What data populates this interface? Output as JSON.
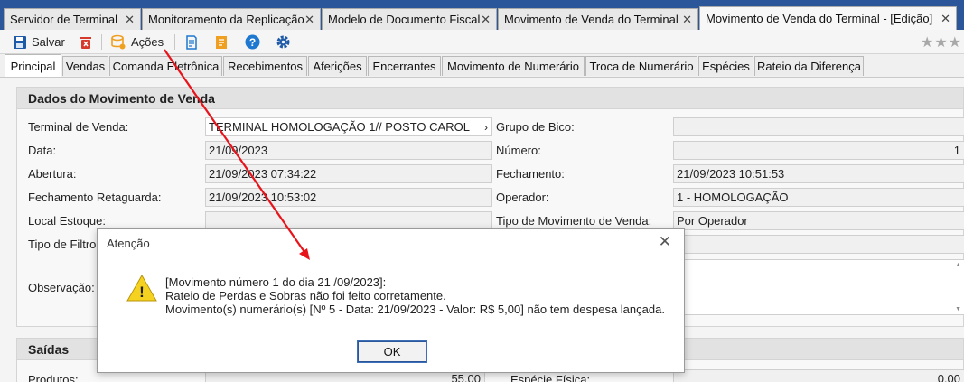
{
  "doc_tabs": [
    {
      "label": "Servidor de Terminal"
    },
    {
      "label": "Monitoramento da Replicação"
    },
    {
      "label": "Modelo de Documento Fiscal"
    },
    {
      "label": "Movimento de Venda do Terminal"
    },
    {
      "label": "Movimento de Venda do Terminal - [Edição]"
    }
  ],
  "close_glyph": "✕",
  "toolbar": {
    "save_label": "Salvar",
    "actions_label": "Ações",
    "help_glyph": "?",
    "stars": "★★★"
  },
  "page_tabs": [
    {
      "label": "Principal"
    },
    {
      "label": "Vendas"
    },
    {
      "label": "Comanda Eletrônica"
    },
    {
      "label": "Recebimentos"
    },
    {
      "label": "Aferições"
    },
    {
      "label": "Encerrantes"
    },
    {
      "label": "Movimento de Numerário"
    },
    {
      "label": "Troca de Numerário"
    },
    {
      "label": "Espécies"
    },
    {
      "label": "Rateio da Diferença"
    }
  ],
  "dados": {
    "title": "Dados do Movimento de Venda",
    "terminal_label": "Terminal de Venda:",
    "terminal_value": "TERMINAL HOMOLOGAÇÃO 1// POSTO CAROL",
    "terminal_arrow": "›",
    "grupo_label": "Grupo de Bico:",
    "grupo_value": "",
    "data_label": "Data:",
    "data_value": "21/09/2023",
    "numero_label": "Número:",
    "numero_value": "1",
    "abertura_label": "Abertura:",
    "abertura_value": "21/09/2023 07:34:22",
    "fechamento_label": "Fechamento:",
    "fechamento_value": "21/09/2023 10:51:53",
    "fech_ret_label": "Fechamento Retaguarda:",
    "fech_ret_value": "21/09/2023 10:53:02",
    "operador_label": "Operador:",
    "operador_value": "1 - HOMOLOGAÇÃO",
    "local_label": "Local Estoque:",
    "local_value": "",
    "tipo_mov_label": "Tipo de Movimento de Venda:",
    "tipo_mov_value": "Por Operador",
    "tipo_filtro_label": "Tipo de Filtro",
    "obs_label": "Observação:"
  },
  "saidas": {
    "title": "Saídas",
    "produtos_label": "Produtos:",
    "produtos_value": "55,00",
    "especie_label": "Espécie Física:",
    "especie_value": "0,00"
  },
  "dialog": {
    "title": "Atenção",
    "close_glyph": "✕",
    "line1": "[Movimento número 1 do dia 21 /09/2023]:",
    "line2": "Rateio de Perdas e Sobras não foi feito corretamente.",
    "line3": "Movimento(s) numerário(s) [Nº 5 - Data: 21/09/2023 - Valor: R$ 5,00] não tem despesa lançada.",
    "ok_label": "OK",
    "warning_glyph": "!"
  },
  "colors": {
    "title_bar": "#2b579a",
    "save_icon": "#1e5aa8",
    "delete_icon": "#d63a2c",
    "actions_icon": "#f0a020",
    "help_icon": "#1e78d0",
    "warning": "#f4d21f",
    "annotation_arrow": "#e8141b"
  }
}
